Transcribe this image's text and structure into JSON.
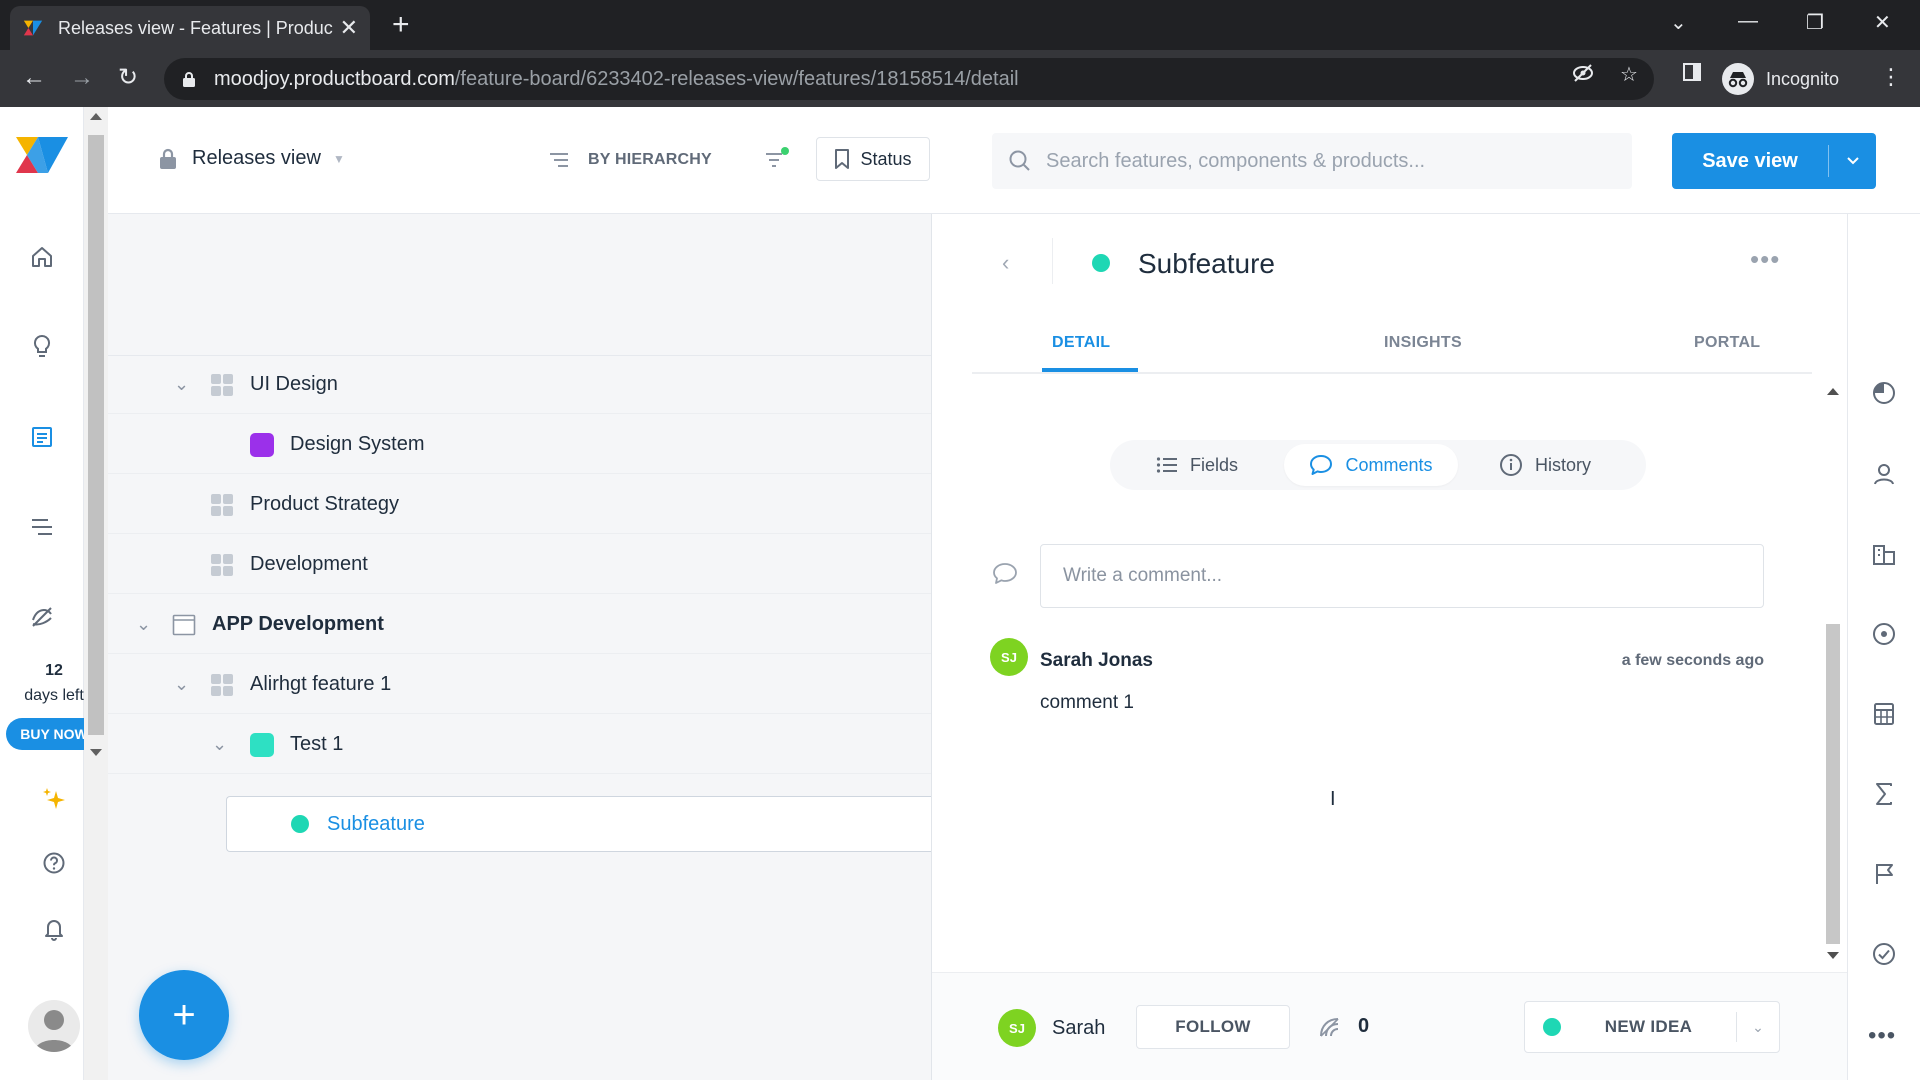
{
  "browser": {
    "tab_title": "Releases view - Features | Produc",
    "url_host": "moodjoy.productboard.com",
    "url_path": "/feature-board/6233402-releases-view/features/18158514/detail",
    "profile_label": "Incognito"
  },
  "toolbar": {
    "view_name": "Releases view",
    "grouping_label": "BY HIERARCHY",
    "status_label": "Status",
    "search_placeholder": "Search features, components & products...",
    "save_view_label": "Save view"
  },
  "left_rail": {
    "trial_days": "12",
    "trial_text": "days left",
    "buy_now_label": "BUY NOW",
    "icons": [
      "home-icon",
      "insights-bulb-icon",
      "features-board-icon",
      "roadmap-icon",
      "portal-icon",
      "sparkle-icon",
      "help-icon",
      "notifications-bell-icon"
    ]
  },
  "board": {
    "rows": [
      {
        "label": "UI Design",
        "type": "component",
        "expanded": true
      },
      {
        "label": "Design System",
        "type": "feature",
        "color": "#9b30ea"
      },
      {
        "label": "Product Strategy",
        "type": "component"
      },
      {
        "label": "Development",
        "type": "component"
      },
      {
        "label": "APP Development",
        "type": "product",
        "expanded": true
      },
      {
        "label": "Alirhgt feature 1",
        "type": "component",
        "expanded": true
      },
      {
        "label": "Test 1",
        "type": "feature",
        "color": "#2ee0c3",
        "expanded": true
      },
      {
        "label": "Subfeature",
        "type": "subfeature",
        "color": "#1ed7b4",
        "selected": true
      }
    ]
  },
  "detail": {
    "title": "Subfeature",
    "tabs": [
      {
        "label": "DETAIL",
        "active": true
      },
      {
        "label": "INSIGHTS",
        "active": false
      },
      {
        "label": "PORTAL",
        "active": false
      }
    ],
    "segments": [
      {
        "label": "Fields",
        "active": false
      },
      {
        "label": "Comments",
        "active": true
      },
      {
        "label": "History",
        "active": false
      }
    ],
    "comment_placeholder": "Write a comment...",
    "comments": [
      {
        "initials": "SJ",
        "author": "Sarah Jonas",
        "time": "a few seconds ago",
        "body": "comment 1"
      }
    ],
    "footer": {
      "owner_initials": "SJ",
      "owner_name": "Sarah",
      "follow_label": "FOLLOW",
      "votes": "0",
      "status_label": "NEW IDEA",
      "status_color": "#1ed7b4"
    }
  },
  "right_rail": {
    "icons": [
      "timeline-icon",
      "user-icon",
      "buildings-icon",
      "target-icon",
      "calculator-icon",
      "sigma-icon",
      "flag-icon",
      "check-circle-icon",
      "more-icon"
    ]
  },
  "colors": {
    "accent": "#1a8fe3",
    "status_teal": "#1ed7b4",
    "avatar_green": "#7ed321"
  }
}
